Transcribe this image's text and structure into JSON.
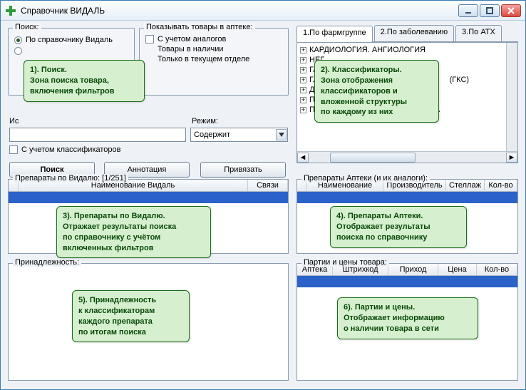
{
  "window": {
    "title": "Справочник ВИДАЛЬ"
  },
  "search": {
    "groupLabel": "Поиск:",
    "radio1": "По справочнику Видаль",
    "sourceLabel": "Ис",
    "modeLabel": "Режим:",
    "modeValue": "Содержит",
    "classifiersCheck": "С учетом классификаторов"
  },
  "show": {
    "groupLabel": "Показывать товары в аптеке:",
    "opt1": "С учетом аналогов",
    "opt2": "Товары в наличии",
    "opt3": "Только в текущем отделе"
  },
  "buttons": {
    "search": "Поиск",
    "annot": "Аннотация",
    "bind": "Привязать"
  },
  "tabs": {
    "t1": "1.По фармгруппе",
    "t2": "2.По заболеванию",
    "t3": "3.По АТХ"
  },
  "tree": {
    "items": [
      "КАРДИОЛОГИЯ. АНГИОЛОГИЯ",
      "НЕГ",
      "ГА",
      "ГЛ",
      "ДЕ",
      "ПРОТ",
      "ПРОТИВОГРИБКОВЫЕ СРЕДСТВА"
    ],
    "extra": "(ГКС)"
  },
  "grids": {
    "vidal": {
      "title": "Препараты по Видалю: [1/251]",
      "cols": [
        "Наименование Видаль",
        "Связи"
      ]
    },
    "apteka": {
      "title": "Препараты Аптеки (и их аналоги):",
      "cols": [
        "Наименование",
        "Производитель",
        "Стеллаж",
        "Кол-во"
      ]
    },
    "belong": {
      "title": "Принадлежность:"
    },
    "party": {
      "title": "Партии и цены товара:",
      "cols": [
        "Аптека",
        "Штрихкод",
        "Приход",
        "Цена",
        "Кол-во"
      ]
    }
  },
  "callouts": {
    "c1": "1). Поиск.\nЗона поиска товара,\nвключения фильтров",
    "c2": "2). Классификаторы.\nЗона отображения\nклассификаторов и\nвложенной структуры\nпо каждому из них",
    "c3": "3). Препараты по Видалю.\nОтражает результаты поиска\nпо справочнику с учётом\nвключенных фильтров",
    "c4": "4). Препараты Аптеки.\nОтображает результаты\nпоиска по справочнику",
    "c5": "5). Принадлежность\nк классификаторам\nкаждого препарата\nпо итогам поиска",
    "c6": "6). Партии и цены.\nОтображает информацию\nо наличии товара в сети"
  }
}
